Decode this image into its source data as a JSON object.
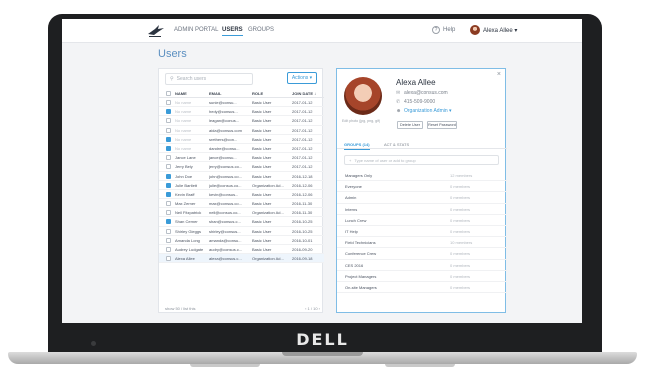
{
  "device": {
    "brand": "DELL"
  },
  "nav": {
    "items": [
      "ADMIN PORTAL",
      "USERS",
      "GROUPS"
    ],
    "active": "USERS",
    "help_label": "Help",
    "user_label": "Alexa Allee ▾"
  },
  "page": {
    "title": "Users"
  },
  "users": {
    "search_placeholder": "Search users",
    "actions_label": "Actions ▾",
    "columns": [
      "NAME",
      "EMAIL",
      "ROLE",
      "JOIN DATE ↓"
    ],
    "rows": [
      {
        "name": "No name",
        "email": "sunie@consu...",
        "role": "Basic User",
        "date": "2017-01-12",
        "checked": false,
        "grey": true
      },
      {
        "name": "No name",
        "email": "hedy@consus...",
        "role": "Basic User",
        "date": "2017-01-12",
        "checked": true,
        "grey": true
      },
      {
        "name": "No name",
        "email": "leagan@conus...",
        "role": "Basic User",
        "date": "2017-01-12",
        "checked": false,
        "grey": true
      },
      {
        "name": "No name",
        "email": "aida@consus.com",
        "role": "Basic User",
        "date": "2017-01-12",
        "checked": false,
        "grey": true
      },
      {
        "name": "No name",
        "email": "srethers@con...",
        "role": "Basic User",
        "date": "2017-01-12",
        "checked": true,
        "grey": true
      },
      {
        "name": "No name",
        "email": "dandre@consu...",
        "role": "Basic User",
        "date": "2017-01-12",
        "checked": true,
        "grey": true
      },
      {
        "name": "Jance Lane",
        "email": "jance@consu...",
        "role": "Basic User",
        "date": "2017-01-12",
        "checked": false,
        "grey": false
      },
      {
        "name": "Jerry Bely",
        "email": "jerry@consus.co...",
        "role": "Basic User",
        "date": "2017-01-12",
        "checked": false,
        "grey": false
      },
      {
        "name": "John Doe",
        "email": "john@consus.co...",
        "role": "Basic User",
        "date": "2016-12-18",
        "checked": true,
        "grey": false
      },
      {
        "name": "Julie Bartlett",
        "email": "julie@consus.co...",
        "role": "Organization Ad...",
        "date": "2016-12-06",
        "checked": true,
        "grey": false
      },
      {
        "name": "Kevin Braff",
        "email": "kevin@consus...",
        "role": "Basic User",
        "date": "2016-12-06",
        "checked": true,
        "grey": false
      },
      {
        "name": "Max Zerner",
        "email": "max@consus.co...",
        "role": "Basic User",
        "date": "2016-11-30",
        "checked": false,
        "grey": false
      },
      {
        "name": "Neil Fitzpatrick",
        "email": "neil@consus.co...",
        "role": "Organization Ad...",
        "date": "2016-11-30",
        "checked": false,
        "grey": false
      },
      {
        "name": "Shan Cerner",
        "email": "shan@consus.c...",
        "role": "Basic User",
        "date": "2016-10-25",
        "checked": true,
        "grey": false
      },
      {
        "name": "Shirley Gieggs",
        "email": "shirley@consus...",
        "role": "Basic User",
        "date": "2016-10-25",
        "checked": false,
        "grey": false
      },
      {
        "name": "Amanda Long",
        "email": "amanda@consu...",
        "role": "Basic User",
        "date": "2016-10-01",
        "checked": false,
        "grey": false
      },
      {
        "name": "Audrey Ludgate",
        "email": "audry@consus.c...",
        "role": "Basic User",
        "date": "2016-09-20",
        "checked": false,
        "grey": false
      },
      {
        "name": "Alexa Allee",
        "email": "alexa@consus.c...",
        "role": "Organization Ad...",
        "date": "2016-09-18",
        "checked": false,
        "grey": false,
        "highlight": true
      }
    ],
    "footer_left": "show 50 / list this",
    "footer_pager": "‹ 1 / 10 ›"
  },
  "detail": {
    "name": "Alexa Allee",
    "email": "alexa@consus.com",
    "phone": "415-509-9000",
    "role": "Organization Admin ▾",
    "edit_photo": "Edit photo (jpg, png, gif)",
    "delete_label": "Delete User",
    "reset_label": "Reset Password",
    "tabs": [
      "GROUPS (14)",
      "ACT & STATS"
    ],
    "group_search_placeholder": "Type name of user or add to group",
    "groups": [
      {
        "name": "Managers Only",
        "count": "12 members"
      },
      {
        "name": "Everyone",
        "count": "0 members"
      },
      {
        "name": "Admin",
        "count": "0 members"
      },
      {
        "name": "Interns",
        "count": "0 members"
      },
      {
        "name": "Lunch Crew",
        "count": "0 members"
      },
      {
        "name": "IT Help",
        "count": "0 members"
      },
      {
        "name": "Field Technicians",
        "count": "10 members"
      },
      {
        "name": "Conference Crew",
        "count": "0 members"
      },
      {
        "name": "CES 2016",
        "count": "0 members"
      },
      {
        "name": "Project Managers",
        "count": "0 members"
      },
      {
        "name": "On-site Managers",
        "count": "0 members"
      }
    ]
  }
}
